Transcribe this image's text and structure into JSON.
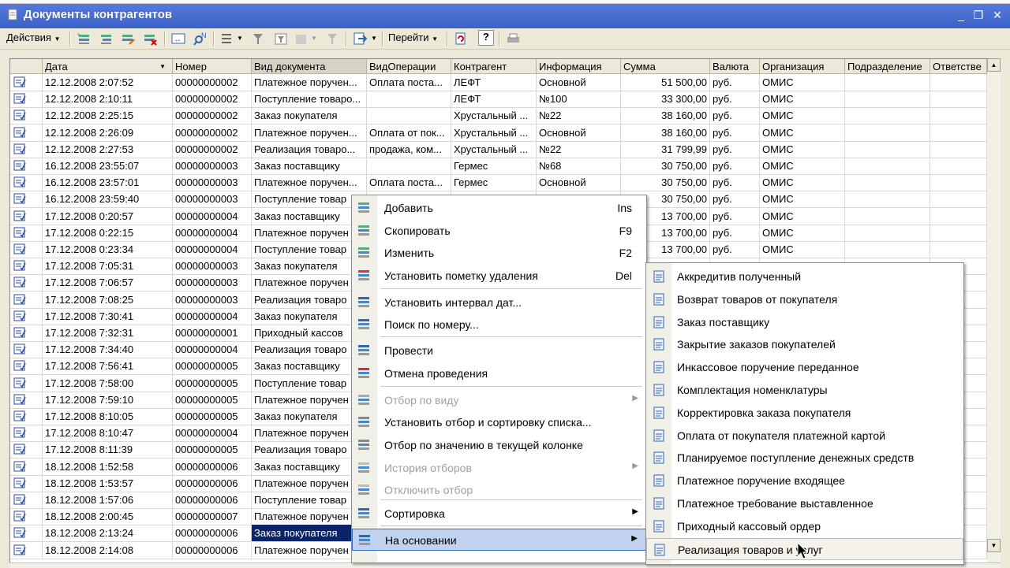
{
  "window": {
    "title": "Документы контрагентов",
    "minimize": "_",
    "restore": "❐",
    "close": "✕"
  },
  "toolbar": {
    "actions_label": "Действия",
    "goto_label": "Перейти",
    "help_label": "?"
  },
  "columns": [
    "Дата",
    "Номер",
    "Вид документа",
    "ВидОперации",
    "Контрагент",
    "Информация",
    "Сумма",
    "Валюта",
    "Организация",
    "Подразделение",
    "Ответстве"
  ],
  "rows": [
    {
      "date": "12.12.2008 2:07:52",
      "num": "00000000002",
      "doc": "Платежное поручен...",
      "op": "Оплата поста...",
      "contr": "ЛЕФТ",
      "info": "Основной",
      "sum": "51 500,00",
      "cur": "руб.",
      "org": "ОМИС"
    },
    {
      "date": "12.12.2008 2:10:11",
      "num": "00000000002",
      "doc": "Поступление товаро...",
      "op": "",
      "contr": "ЛЕФТ",
      "info": "№100",
      "sum": "33 300,00",
      "cur": "руб.",
      "org": "ОМИС"
    },
    {
      "date": "12.12.2008 2:25:15",
      "num": "00000000002",
      "doc": "Заказ покупателя",
      "op": "",
      "contr": "Хрустальный ...",
      "info": "№22",
      "sum": "38 160,00",
      "cur": "руб.",
      "org": "ОМИС"
    },
    {
      "date": "12.12.2008 2:26:09",
      "num": "00000000002",
      "doc": "Платежное поручен...",
      "op": "Оплата от пок...",
      "contr": "Хрустальный ...",
      "info": "Основной",
      "sum": "38 160,00",
      "cur": "руб.",
      "org": "ОМИС"
    },
    {
      "date": "12.12.2008 2:27:53",
      "num": "00000000002",
      "doc": "Реализация товаро...",
      "op": "продажа, ком...",
      "contr": "Хрустальный ...",
      "info": "№22",
      "sum": "31 799,99",
      "cur": "руб.",
      "org": "ОМИС"
    },
    {
      "date": "16.12.2008 23:55:07",
      "num": "00000000003",
      "doc": "Заказ поставщику",
      "op": "",
      "contr": "Гермес",
      "info": "№68",
      "sum": "30 750,00",
      "cur": "руб.",
      "org": "ОМИС"
    },
    {
      "date": "16.12.2008 23:57:01",
      "num": "00000000003",
      "doc": "Платежное поручен...",
      "op": "Оплата поста...",
      "contr": "Гермес",
      "info": "Основной",
      "sum": "30 750,00",
      "cur": "руб.",
      "org": "ОМИС"
    },
    {
      "date": "16.12.2008 23:59:40",
      "num": "00000000003",
      "doc": "Поступление товар",
      "op": "",
      "contr": "",
      "info": "",
      "sum": "30 750,00",
      "cur": "руб.",
      "org": "ОМИС"
    },
    {
      "date": "17.12.2008 0:20:57",
      "num": "00000000004",
      "doc": "Заказ поставщику",
      "op": "",
      "contr": "",
      "info": "",
      "sum": "13 700,00",
      "cur": "руб.",
      "org": "ОМИС"
    },
    {
      "date": "17.12.2008 0:22:15",
      "num": "00000000004",
      "doc": "Платежное поручен",
      "op": "",
      "contr": "",
      "info": "",
      "sum": "13 700,00",
      "cur": "руб.",
      "org": "ОМИС"
    },
    {
      "date": "17.12.2008 0:23:34",
      "num": "00000000004",
      "doc": "Поступление товар",
      "op": "",
      "contr": "",
      "info": "",
      "sum": "13 700,00",
      "cur": "руб.",
      "org": "ОМИС"
    },
    {
      "date": "17.12.2008 7:05:31",
      "num": "00000000003",
      "doc": "Заказ покупателя",
      "op": "",
      "contr": "",
      "info": "",
      "sum": "",
      "cur": "",
      "org": ""
    },
    {
      "date": "17.12.2008 7:06:57",
      "num": "00000000003",
      "doc": "Платежное поручен",
      "op": "",
      "contr": "",
      "info": "",
      "sum": "",
      "cur": "",
      "org": ""
    },
    {
      "date": "17.12.2008 7:08:25",
      "num": "00000000003",
      "doc": "Реализация товаро",
      "op": "",
      "contr": "",
      "info": "",
      "sum": "",
      "cur": "",
      "org": ""
    },
    {
      "date": "17.12.2008 7:30:41",
      "num": "00000000004",
      "doc": "Заказ покупателя",
      "op": "",
      "contr": "",
      "info": "",
      "sum": "",
      "cur": "",
      "org": ""
    },
    {
      "date": "17.12.2008 7:32:31",
      "num": "00000000001",
      "doc": "Приходный кассов",
      "op": "",
      "contr": "",
      "info": "",
      "sum": "",
      "cur": "",
      "org": ""
    },
    {
      "date": "17.12.2008 7:34:40",
      "num": "00000000004",
      "doc": "Реализация товаро",
      "op": "",
      "contr": "",
      "info": "",
      "sum": "",
      "cur": "",
      "org": ""
    },
    {
      "date": "17.12.2008 7:56:41",
      "num": "00000000005",
      "doc": "Заказ поставщику",
      "op": "",
      "contr": "",
      "info": "",
      "sum": "",
      "cur": "",
      "org": ""
    },
    {
      "date": "17.12.2008 7:58:00",
      "num": "00000000005",
      "doc": "Поступление товар",
      "op": "",
      "contr": "",
      "info": "",
      "sum": "",
      "cur": "",
      "org": ""
    },
    {
      "date": "17.12.2008 7:59:10",
      "num": "00000000005",
      "doc": "Платежное поручен",
      "op": "",
      "contr": "",
      "info": "",
      "sum": "",
      "cur": "",
      "org": ""
    },
    {
      "date": "17.12.2008 8:10:05",
      "num": "00000000005",
      "doc": "Заказ покупателя",
      "op": "",
      "contr": "",
      "info": "",
      "sum": "",
      "cur": "",
      "org": ""
    },
    {
      "date": "17.12.2008 8:10:47",
      "num": "00000000004",
      "doc": "Платежное поручен",
      "op": "",
      "contr": "",
      "info": "",
      "sum": "",
      "cur": "",
      "org": ""
    },
    {
      "date": "17.12.2008 8:11:39",
      "num": "00000000005",
      "doc": "Реализация товаро",
      "op": "",
      "contr": "",
      "info": "",
      "sum": "",
      "cur": "",
      "org": ""
    },
    {
      "date": "18.12.2008 1:52:58",
      "num": "00000000006",
      "doc": "Заказ поставщику",
      "op": "",
      "contr": "",
      "info": "",
      "sum": "",
      "cur": "",
      "org": ""
    },
    {
      "date": "18.12.2008 1:53:57",
      "num": "00000000006",
      "doc": "Платежное поручен",
      "op": "",
      "contr": "",
      "info": "",
      "sum": "",
      "cur": "",
      "org": ""
    },
    {
      "date": "18.12.2008 1:57:06",
      "num": "00000000006",
      "doc": "Поступление товар",
      "op": "",
      "contr": "",
      "info": "",
      "sum": "",
      "cur": "",
      "org": ""
    },
    {
      "date": "18.12.2008 2:00:45",
      "num": "00000000007",
      "doc": "Платежное поручен",
      "op": "",
      "contr": "",
      "info": "",
      "sum": "",
      "cur": "",
      "org": ""
    },
    {
      "date": "18.12.2008 2:13:24",
      "num": "00000000006",
      "doc": "Заказ покупателя",
      "op": "",
      "contr": "",
      "info": "",
      "sum": "",
      "cur": "",
      "org": "",
      "selected": true
    },
    {
      "date": "18.12.2008 2:14:08",
      "num": "00000000006",
      "doc": "Платежное поручен",
      "op": "",
      "contr": "",
      "info": "",
      "sum": "",
      "cur": "",
      "org": ""
    }
  ],
  "context_menu": [
    {
      "label": "Добавить",
      "shortcut": "Ins",
      "icon": "add-icon"
    },
    {
      "label": "Скопировать",
      "shortcut": "F9",
      "icon": "copy-icon"
    },
    {
      "label": "Изменить",
      "shortcut": "F2",
      "icon": "edit-icon"
    },
    {
      "label": "Установить пометку удаления",
      "shortcut": "Del",
      "icon": "delete-mark-icon"
    },
    {
      "label": "Установить интервал дат...",
      "shortcut": "",
      "icon": "date-interval-icon"
    },
    {
      "label": "Поиск по номеру...",
      "shortcut": "",
      "icon": "search-number-icon"
    },
    {
      "label": "Провести",
      "shortcut": "",
      "icon": "post-icon"
    },
    {
      "label": "Отмена проведения",
      "shortcut": "",
      "icon": "unpost-icon"
    },
    {
      "label": "Отбор по виду",
      "shortcut": "",
      "icon": "filter-by-type-icon"
    },
    {
      "label": "Установить отбор и сортировку списка...",
      "shortcut": "",
      "icon": "filter-sort-icon"
    },
    {
      "label": "Отбор по значению в текущей колонке",
      "shortcut": "",
      "icon": "filter-value-icon"
    },
    {
      "label": "История отборов",
      "shortcut": "",
      "icon": "filter-history-icon"
    },
    {
      "label": "Отключить отбор",
      "shortcut": "",
      "icon": "filter-off-icon"
    },
    {
      "label": "Сортировка",
      "shortcut": "",
      "icon": "sort-icon"
    },
    {
      "label": "На основании",
      "shortcut": "",
      "icon": "based-on-icon"
    }
  ],
  "submenu": [
    "Аккредитив полученный",
    "Возврат товаров от покупателя",
    "Заказ поставщику",
    "Закрытие заказов покупателей",
    "Инкассовое поручение переданное",
    "Комплектация номенклатуры",
    "Корректировка заказа покупателя",
    "Оплата от покупателя платежной картой",
    "Планируемое поступление денежных средств",
    "Платежное поручение входящее",
    "Платежное требование выставленное",
    "Приходный кассовый ордер",
    "Реализация товаров и услуг"
  ],
  "colors": {
    "selection": "#0a246a",
    "menu_highlight": "#c1d2ee",
    "title": "#3b62c9"
  }
}
